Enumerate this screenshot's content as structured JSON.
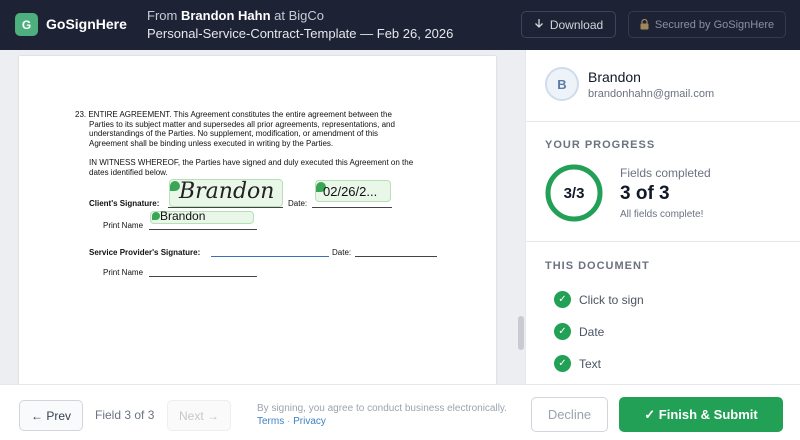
{
  "header": {
    "logo_letter": "G",
    "brand": "GoSignHere",
    "from_prefix": "From",
    "sender_name": "Brandon Hahn",
    "at_company": "at BigCo",
    "doc_title": "Personal-Service-Contract-Template — Feb 26, 2026",
    "download_label": "Download",
    "secured_label": "Secured by GoSignHere"
  },
  "document": {
    "section_number": "23.",
    "section_heading": "ENTIRE AGREEMENT",
    "section_lines": [
      "23. ENTIRE AGREEMENT. This Agreement constitutes the entire agreement between the",
      "Parties to its subject matter and supersedes all prior agreements, representations, and",
      "understandings of the Parties. No supplement, modification, or amendment of this",
      "Agreement shall be binding unless executed in writing by the Parties."
    ],
    "witness_lines": [
      "IN WITNESS WHEREOF, the Parties have signed and duly executed this Agreement on the",
      "dates identified below."
    ],
    "client_sig_label": "Client's Signature:",
    "client_sig_value": "Brandon",
    "date_label": "Date:",
    "date_value": "02/26/2...",
    "print_name_label": "Print Name",
    "print_name_value": "Brandon",
    "provider_sig_label": "Service Provider's Signature:",
    "provider_date_label": "Date:",
    "provider_print_name_label": "Print Name"
  },
  "panel": {
    "avatar_letter": "B",
    "user_name": "Brandon",
    "user_email": "brandonhahn@gmail.com",
    "progress_title": "YOUR PROGRESS",
    "progress_ring_text": "3/3",
    "progress_fraction": 1.0,
    "fields_completed_label": "Fields completed",
    "fields_completed_count": "3 of 3",
    "fields_complete_note": "All fields complete!",
    "document_title": "THIS DOCUMENT",
    "document_items": [
      {
        "label": "Click to sign",
        "icon": "check-icon"
      },
      {
        "label": "Date",
        "icon": "check-icon"
      },
      {
        "label": "Text",
        "icon": "check-icon"
      }
    ]
  },
  "footer": {
    "prev_label": "← Prev",
    "field_indicator": "Field 3 of 3",
    "next_label": "Next →",
    "consent_text": "By signing, you agree to conduct business electronically.",
    "terms_label": "Terms",
    "separator": "·",
    "privacy_label": "Privacy",
    "decline_label": "Decline",
    "finish_label": "✓ Finish & Submit"
  },
  "colors": {
    "header_bg": "#1e2235",
    "accent_green": "#22a055",
    "link_blue": "#3b82c4"
  }
}
